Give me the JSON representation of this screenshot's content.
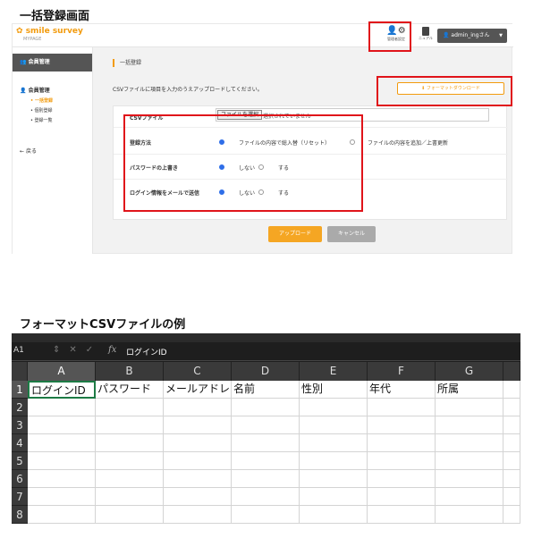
{
  "section1_title": "一括登録画面",
  "section2_title": "フォーマットCSVファイルの例",
  "app": {
    "logo": "smile survey",
    "logo_sub": "MYPAGE",
    "admin_settings_label": "管理者設定",
    "manual_label": "ニュアル",
    "user_button": "admin_ingさん",
    "sidebar": {
      "header": "会員管理",
      "group": "会員管理",
      "items": [
        "一括登録",
        "個別登録",
        "登録一覧"
      ],
      "back": "戻る"
    },
    "page_title": "一括登録",
    "description": "CSVファイルに項目を入力のうえアップロードしてください。",
    "format_download_button": "フォーマットダウンロード",
    "form": {
      "csv_label": "CSVファイル",
      "file_button": "ファイルを選択",
      "file_status": "選択されていません",
      "method_label": "登録方法",
      "method_option1": "ファイルの内容で総入替（リセット）",
      "method_option2": "ファイルの内容を追加／上書更新",
      "password_label": "パスワードの上書き",
      "password_no": "しない",
      "password_yes": "する",
      "login_mail_label": "ログイン情報をメールで送信",
      "login_mail_no": "しない",
      "login_mail_yes": "する"
    },
    "upload_button": "アップロード",
    "cancel_button": "キャンセル",
    "accent_color": "#f29b0e"
  },
  "sheet": {
    "cell_ref": "A1",
    "formula_content": "ログインID",
    "columns": [
      "A",
      "B",
      "C",
      "D",
      "E",
      "F",
      "G"
    ],
    "rows": [
      "1",
      "2",
      "3",
      "4",
      "5",
      "6",
      "7",
      "8"
    ],
    "headers": [
      "ログインID",
      "パスワード",
      "メールアドレ",
      "名前",
      "性別",
      "年代",
      "所属"
    ]
  }
}
